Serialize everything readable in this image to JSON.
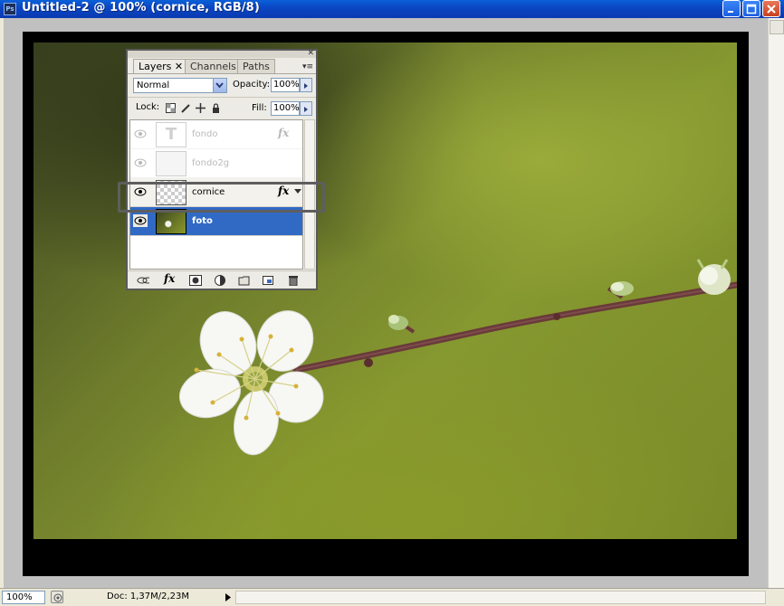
{
  "window": {
    "title": "Untitled-2 @ 100% (cornice, RGB/8)",
    "app_icon_text": "Ps"
  },
  "layers_panel": {
    "tabs": [
      {
        "label": "Layers",
        "active": true
      },
      {
        "label": "Channels",
        "active": false
      },
      {
        "label": "Paths",
        "active": false
      }
    ],
    "blend_mode": "Normal",
    "opacity_label": "Opacity:",
    "opacity_value": "100%",
    "lock_label": "Lock:",
    "fill_label": "Fill:",
    "fill_value": "100%",
    "layers": [
      {
        "name": "fondo",
        "visible": true,
        "faded": true,
        "fx": true,
        "fx_label": "fx"
      },
      {
        "name": "fondo2g",
        "visible": true,
        "faded": true,
        "fx": false
      },
      {
        "name": "cornice",
        "visible": true,
        "faded": false,
        "fx": true,
        "fx_label": "fx",
        "highlighted": true
      },
      {
        "name": "foto",
        "visible": true,
        "faded": false,
        "fx": false,
        "selected": true
      }
    ],
    "bottom_icons": [
      "link-icon",
      "fx-icon",
      "mask-icon",
      "adjustment-icon",
      "folder-icon",
      "new-layer-icon",
      "trash-icon"
    ],
    "bottom_fx_label": "fx"
  },
  "status": {
    "zoom": "100%",
    "doc_info": "Doc: 1,37M/2,23M"
  },
  "colors": {
    "titlebar": "#0b47c4",
    "selection": "#316ac5"
  }
}
